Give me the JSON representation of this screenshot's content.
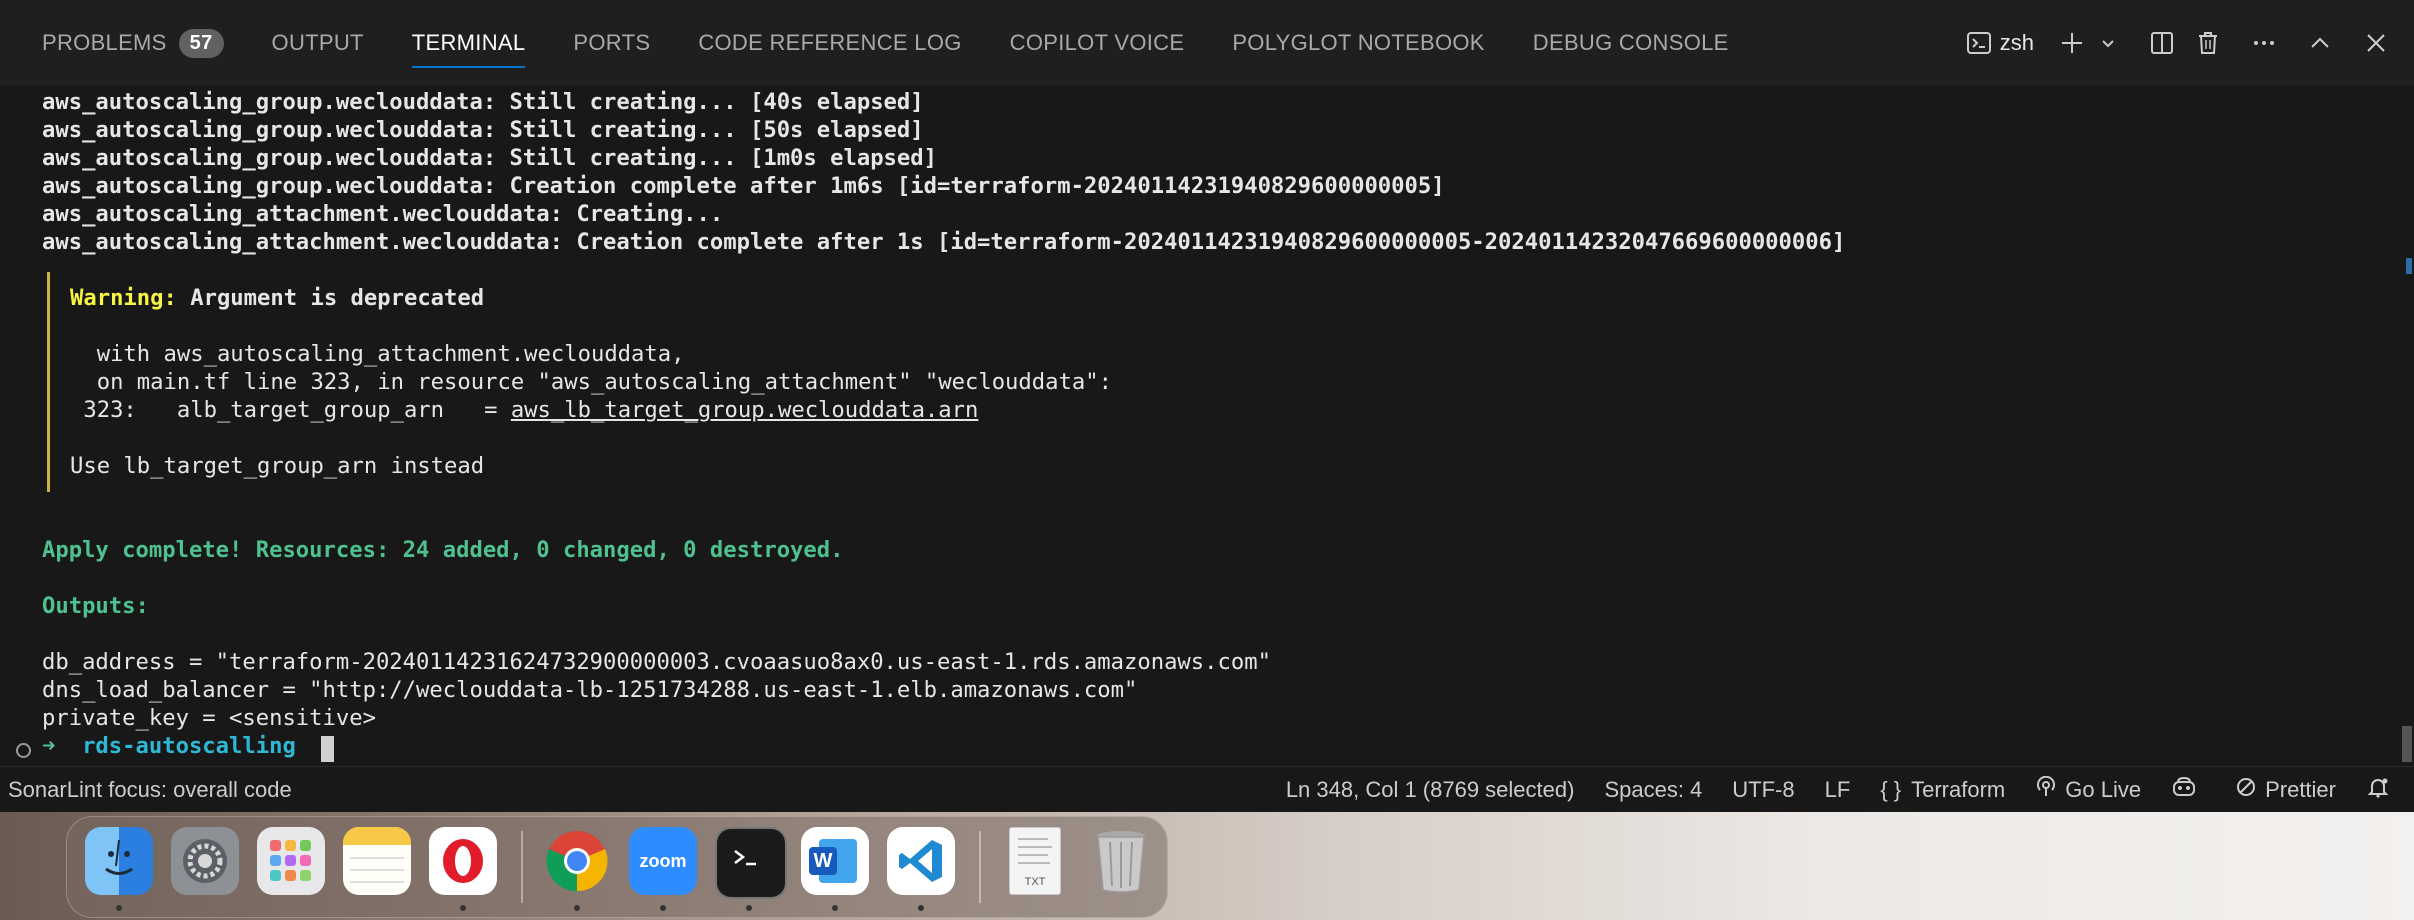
{
  "panel": {
    "tabs": [
      {
        "label": "PROBLEMS",
        "badge": "57"
      },
      {
        "label": "OUTPUT"
      },
      {
        "label": "TERMINAL"
      },
      {
        "label": "PORTS"
      },
      {
        "label": "CODE REFERENCE LOG"
      },
      {
        "label": "COPILOT VOICE"
      },
      {
        "label": "POLYGLOT NOTEBOOK"
      },
      {
        "label": "DEBUG CONSOLE"
      }
    ],
    "active_tab": "TERMINAL",
    "shell": "zsh"
  },
  "terminal": {
    "lines": [
      "aws_autoscaling_group.weclouddata: Still creating... [40s elapsed]",
      "aws_autoscaling_group.weclouddata: Still creating... [50s elapsed]",
      "aws_autoscaling_group.weclouddata: Still creating... [1m0s elapsed]",
      "aws_autoscaling_group.weclouddata: Creation complete after 1m6s [id=terraform-20240114231940829600000005]",
      "aws_autoscaling_attachment.weclouddata: Creating...",
      "aws_autoscaling_attachment.weclouddata: Creation complete after 1s [id=terraform-20240114231940829600000005-20240114232047669600000006]"
    ],
    "warning": {
      "label": "Warning:",
      "message": "Argument is deprecated",
      "with_line": "  with aws_autoscaling_attachment.weclouddata,",
      "on_line": "  on main.tf line 323, in resource \"aws_autoscaling_attachment\" \"weclouddata\":",
      "code_prefix": " 323:   alb_target_group_arn   = ",
      "code_ref": "aws_lb_target_group.weclouddata.arn",
      "advice": "Use lb_target_group_arn instead"
    },
    "apply_complete": "Apply complete! Resources: 24 added, 0 changed, 0 destroyed.",
    "outputs_label": "Outputs:",
    "outputs": [
      "db_address = \"terraform-20240114231624732900000003.cvoaasuo8ax0.us-east-1.rds.amazonaws.com\"",
      "dns_load_balancer = \"http://weclouddata-lb-1251734288.us-east-1.elb.amazonaws.com\"",
      "private_key = <sensitive>"
    ],
    "prompt_arrow": "➜",
    "prompt_dir": "rds-autoscalling"
  },
  "statusbar": {
    "left": "SonarLint focus: overall code",
    "position": "Ln 348, Col 1 (8769 selected)",
    "spaces": "Spaces: 4",
    "encoding": "UTF-8",
    "eol": "LF",
    "language": "Terraform",
    "golive": "Go Live",
    "prettier": "Prettier"
  },
  "dock": {
    "apps": [
      "finder-icon",
      "system-settings-icon",
      "launchpad-icon",
      "notes-icon",
      "opera-icon",
      "chrome-icon",
      "zoom-icon",
      "terminal-icon",
      "word-icon",
      "vscode-icon",
      "text-document-icon",
      "trash-icon"
    ],
    "zoom_label": "zoom",
    "doc_label": "TXT",
    "word_label": "W"
  },
  "colors": {
    "terminal_bg": "#181818",
    "warning": "#f5f543",
    "success": "#4fc18f",
    "prompt": "#2fb7d6",
    "accent": "#0078d4"
  }
}
